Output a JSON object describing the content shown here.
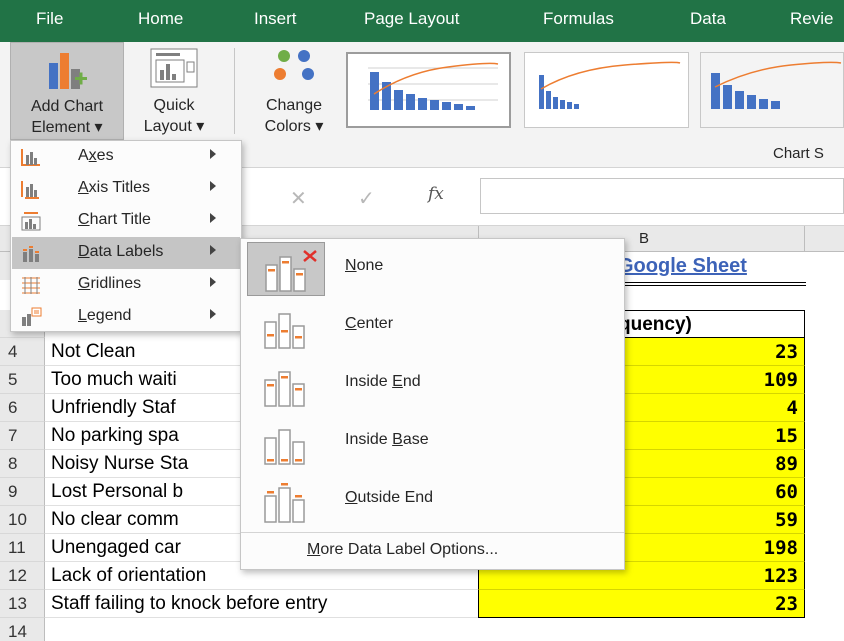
{
  "ribbon_tabs": [
    "File",
    "Home",
    "Insert",
    "Page Layout",
    "Formulas",
    "Data",
    "Revie"
  ],
  "ribbon": {
    "add_chart_line1": "Add Chart",
    "add_chart_line2": "Element ▾",
    "quick_layout_line1": "Quick",
    "quick_layout_line2": "Layout ▾",
    "change_colors_line1": "Change",
    "change_colors_line2": "Colors ▾",
    "chart_styles_label": "Chart S"
  },
  "formula_bar": {
    "cancel": "✕",
    "enter": "✓",
    "fx": "fx",
    "value": ""
  },
  "column_header_B": "B",
  "sheet": {
    "title_text": "Google Sheet",
    "header_b": "quency)",
    "rows": [
      {
        "num": "4",
        "a": "Not Clean",
        "b": "23"
      },
      {
        "num": "5",
        "a": "Too much waiti",
        "b": "109"
      },
      {
        "num": "6",
        "a": "Unfriendly Staf",
        "b": "4"
      },
      {
        "num": "7",
        "a": "No parking spa",
        "b": "15"
      },
      {
        "num": "8",
        "a": "Noisy Nurse Sta",
        "b": "89"
      },
      {
        "num": "9",
        "a": "Lost Personal b",
        "b": "60"
      },
      {
        "num": "10",
        "a": "No clear comm",
        "b": "59"
      },
      {
        "num": "11",
        "a": "Unengaged car",
        "b": "198"
      },
      {
        "num": "12",
        "a": "Lack of orientation",
        "b": "123"
      },
      {
        "num": "13",
        "a": "Staff failing to knock before entry",
        "b": "23"
      },
      {
        "num": "14",
        "a": "",
        "b": ""
      }
    ]
  },
  "add_chart_menu": {
    "items": [
      {
        "label_pre": "A",
        "label_u": "x",
        "label_post": "es",
        "icon": "axes-icon"
      },
      {
        "label_pre": "",
        "label_u": "A",
        "label_post": "xis Titles",
        "icon": "axis-titles-icon"
      },
      {
        "label_pre": "",
        "label_u": "C",
        "label_post": "hart Title",
        "icon": "chart-title-icon"
      },
      {
        "label_pre": "",
        "label_u": "D",
        "label_post": "ata Labels",
        "icon": "data-labels-icon"
      },
      {
        "label_pre": "",
        "label_u": "G",
        "label_post": "ridlines",
        "icon": "gridlines-icon"
      },
      {
        "label_pre": "",
        "label_u": "L",
        "label_post": "egend",
        "icon": "legend-icon"
      }
    ],
    "highlighted": "Data Labels"
  },
  "data_labels_menu": {
    "items": [
      {
        "label_pre": "",
        "label_u": "N",
        "label_post": "one",
        "icon": "none-labels-icon"
      },
      {
        "label_pre": "",
        "label_u": "C",
        "label_post": "enter",
        "icon": "center-labels-icon"
      },
      {
        "label_pre": "Inside ",
        "label_u": "E",
        "label_post": "nd",
        "icon": "inside-end-labels-icon"
      },
      {
        "label_pre": "Inside ",
        "label_u": "B",
        "label_post": "ase",
        "icon": "inside-base-labels-icon"
      },
      {
        "label_pre": "",
        "label_u": "O",
        "label_post": "utside End",
        "icon": "outside-end-labels-icon"
      }
    ],
    "selected": "None",
    "more_pre": "",
    "more_u": "M",
    "more_post": "ore Data Label Options..."
  },
  "colors": {
    "ribbon_green": "#217346",
    "highlight_yellow": "#ffff00",
    "accent_orange": "#ed7d31",
    "accent_blue": "#4472c4"
  }
}
